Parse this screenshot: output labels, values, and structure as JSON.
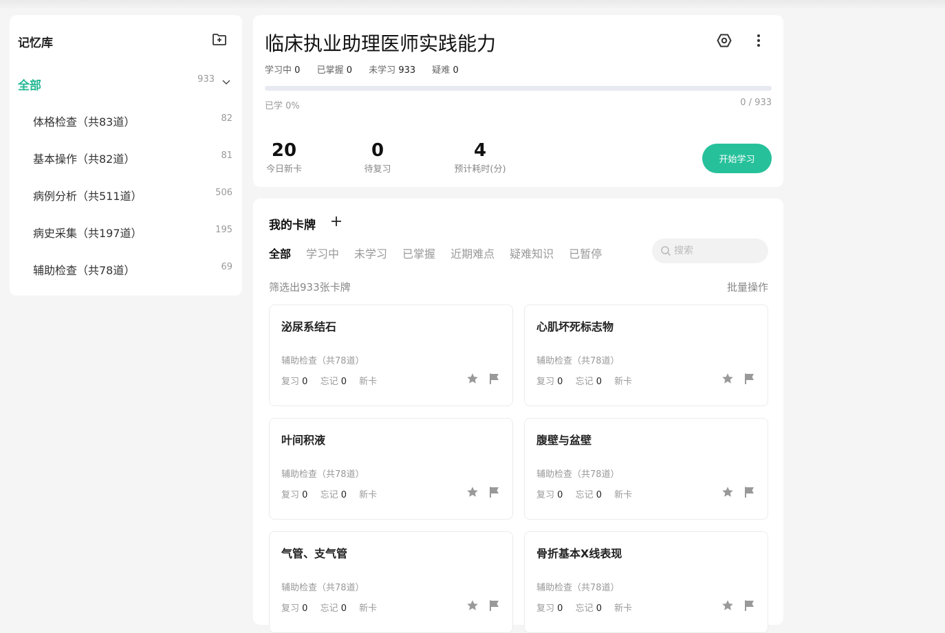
{
  "sidebar": {
    "title": "记忆库",
    "all": {
      "label": "全部",
      "count": "933"
    },
    "items": [
      {
        "label": "体格检查（共83道）",
        "count": "82"
      },
      {
        "label": "基本操作（共82道）",
        "count": "81"
      },
      {
        "label": "病例分析（共511道）",
        "count": "506"
      },
      {
        "label": "病史采集（共197道）",
        "count": "195"
      },
      {
        "label": "辅助检查（共78道）",
        "count": "69"
      }
    ]
  },
  "header": {
    "title": "临床执业助理医师实践能力",
    "stats": [
      {
        "label": "学习中",
        "value": "0"
      },
      {
        "label": "已掌握",
        "value": "0"
      },
      {
        "label": "未学习",
        "value": "933"
      },
      {
        "label": "疑难",
        "value": "0"
      }
    ],
    "progress_fraction": 0,
    "learned_text": "已学 0%",
    "ratio_text": "0 / 933",
    "metrics": [
      {
        "value": "20",
        "label": "今日新卡"
      },
      {
        "value": "0",
        "label": "待复习"
      },
      {
        "value": "4",
        "label": "预计耗时(分)"
      }
    ],
    "start_label": "开始学习"
  },
  "cards_panel": {
    "title": "我的卡牌",
    "tabs": [
      "全部",
      "学习中",
      "未学习",
      "已掌握",
      "近期难点",
      "疑难知识",
      "已暂停"
    ],
    "active_tab": "全部",
    "search_placeholder": "搜索",
    "filter_text": "筛选出933张卡牌",
    "batch_label": "批量操作",
    "cards": [
      {
        "title": "泌尿系结石",
        "category": "辅助检查（共78道）",
        "review_label": "复习",
        "review": "0",
        "forget_label": "忘记",
        "forget": "0",
        "status": "新卡"
      },
      {
        "title": "心肌坏死标志物",
        "category": "辅助检查（共78道）",
        "review_label": "复习",
        "review": "0",
        "forget_label": "忘记",
        "forget": "0",
        "status": "新卡"
      },
      {
        "title": "叶间积液",
        "category": "辅助检查（共78道）",
        "review_label": "复习",
        "review": "0",
        "forget_label": "忘记",
        "forget": "0",
        "status": "新卡"
      },
      {
        "title": "腹壁与盆壁",
        "category": "辅助检查（共78道）",
        "review_label": "复习",
        "review": "0",
        "forget_label": "忘记",
        "forget": "0",
        "status": "新卡"
      },
      {
        "title": "气管、支气管",
        "category": "辅助检查（共78道）",
        "review_label": "复习",
        "review": "0",
        "forget_label": "忘记",
        "forget": "0",
        "status": "新卡"
      },
      {
        "title": "骨折基本X线表现",
        "category": "辅助检查（共78道）",
        "review_label": "复习",
        "review": "0",
        "forget_label": "忘记",
        "forget": "0",
        "status": "新卡"
      }
    ]
  },
  "colors": {
    "accent": "#26b894",
    "button": "#26c19b",
    "icon_gray": "#999999"
  },
  "icons": [
    "folder-add-icon",
    "chevron-down-icon",
    "settings-icon",
    "more-vertical-icon",
    "plus-icon",
    "search-icon",
    "star-icon",
    "flag-icon"
  ]
}
